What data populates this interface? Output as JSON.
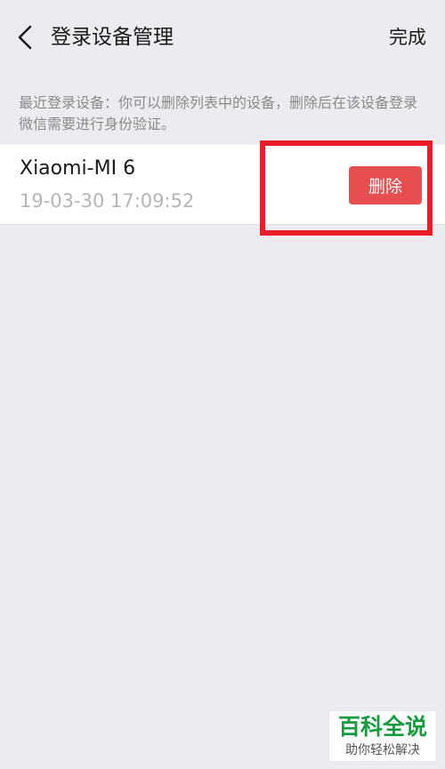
{
  "header": {
    "back_icon": "chevron-left-icon",
    "title": "登录设备管理",
    "done_label": "完成"
  },
  "description": "最近登录设备：你可以删除列表中的设备，删除后在该设备登录微信需要进行身份验证。",
  "devices": [
    {
      "name": "Xiaomi-MI 6",
      "last_login": "19-03-30 17:09:52",
      "delete_label": "删除"
    }
  ],
  "watermark": {
    "title": "百科全说",
    "subtitle": "助你轻松解决"
  },
  "colors": {
    "background": "#edebef",
    "delete_button": "#e64e50",
    "highlight_border": "#ea1d2a",
    "watermark_green": "#179b3f"
  }
}
